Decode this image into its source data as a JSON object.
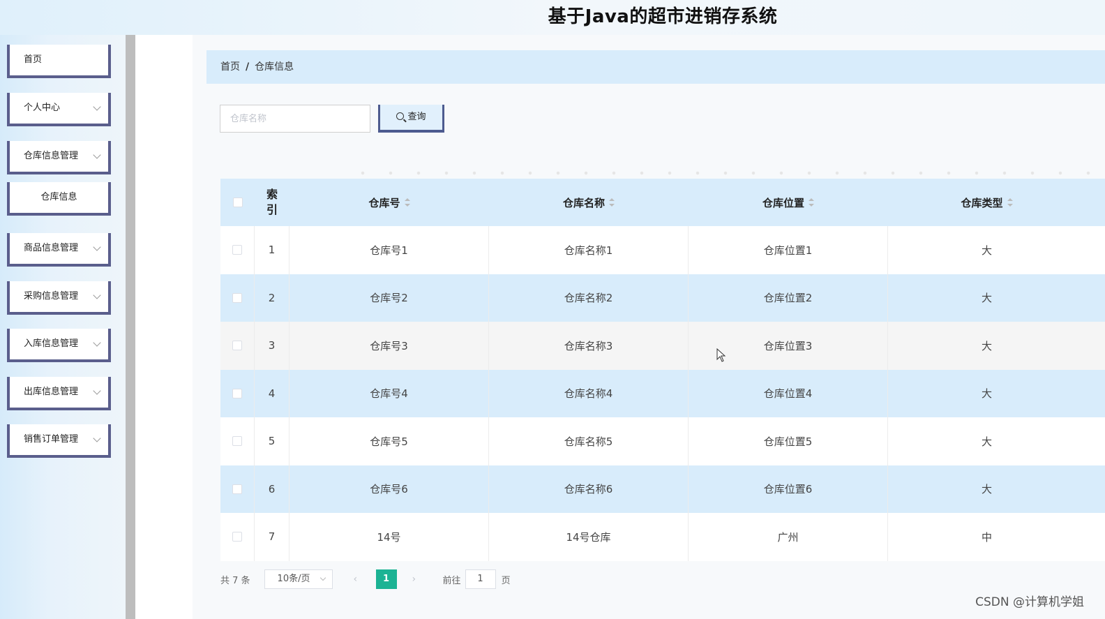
{
  "app": {
    "title": "基于Java的超市进销存系统"
  },
  "sidebar": {
    "items": [
      {
        "label": "首页",
        "has_chevron": false
      },
      {
        "label": "个人中心",
        "has_chevron": true
      },
      {
        "label": "仓库信息管理",
        "has_chevron": true
      },
      {
        "label": "仓库信息",
        "has_chevron": false,
        "sub": true
      },
      {
        "label": "商品信息管理",
        "has_chevron": true
      },
      {
        "label": "采购信息管理",
        "has_chevron": true
      },
      {
        "label": "入库信息管理",
        "has_chevron": true
      },
      {
        "label": "出库信息管理",
        "has_chevron": true
      },
      {
        "label": "销售订单管理",
        "has_chevron": true
      }
    ]
  },
  "breadcrumb": {
    "home": "首页",
    "separator": "/",
    "current": "仓库信息"
  },
  "search": {
    "placeholder": "仓库名称",
    "value": "",
    "button_label": "查询",
    "button_icon": "search-icon"
  },
  "table": {
    "headers": {
      "index": [
        "索",
        "引"
      ],
      "col1": "仓库号",
      "col2": "仓库名称",
      "col3": "仓库位置",
      "col4": "仓库类型"
    },
    "rows": [
      {
        "index": "1",
        "col1": "仓库号1",
        "col2": "仓库名称1",
        "col3": "仓库位置1",
        "col4": "大"
      },
      {
        "index": "2",
        "col1": "仓库号2",
        "col2": "仓库名称2",
        "col3": "仓库位置2",
        "col4": "大"
      },
      {
        "index": "3",
        "col1": "仓库号3",
        "col2": "仓库名称3",
        "col3": "仓库位置3",
        "col4": "大"
      },
      {
        "index": "4",
        "col1": "仓库号4",
        "col2": "仓库名称4",
        "col3": "仓库位置4",
        "col4": "大"
      },
      {
        "index": "5",
        "col1": "仓库号5",
        "col2": "仓库名称5",
        "col3": "仓库位置5",
        "col4": "大"
      },
      {
        "index": "6",
        "col1": "仓库号6",
        "col2": "仓库名称6",
        "col3": "仓库位置6",
        "col4": "大"
      },
      {
        "index": "7",
        "col1": "14号",
        "col2": "14号仓库",
        "col3": "广州",
        "col4": "中"
      }
    ]
  },
  "pagination": {
    "total_text": "共 7 条",
    "page_size": "10条/页",
    "current_page": "1",
    "goto_label": "前往",
    "goto_value": "1",
    "goto_suffix": "页"
  },
  "watermark": "CSDN @计算机学姐",
  "colors": {
    "accent": "#1cb394",
    "header_bg": "#d8ecfb",
    "menu_border": "#5a5e8c"
  }
}
